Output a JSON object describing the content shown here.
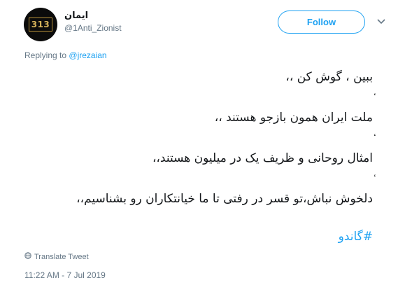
{
  "author": {
    "display_name": "ایمان",
    "handle": "@1Anti_Zionist",
    "avatar_text": "313"
  },
  "follow_button": {
    "label": "Follow"
  },
  "menu": {
    "icon": "chevron-down-icon"
  },
  "reply_context": {
    "prefix": "Replying to",
    "mention": "@jrezaian"
  },
  "tweet": {
    "lines": [
      "ببین ، گوش کن ،،",
      "ٔ",
      "ملت ایران همون بازجو هستند ،،",
      "ٔ",
      "امثال روحانی و ظریف یک در میلیون هستند،،",
      "ٔ",
      "دلخوش نباش،تو قسر در رفتی تا ما خیانتکاران رو بشناسیم،،"
    ],
    "hashtag": "#گاندو"
  },
  "translate": {
    "label": "Translate Tweet",
    "icon": "globe-icon"
  },
  "timestamp": "11:22 AM - 7 Jul 2019",
  "colors": {
    "accent": "#1da1f2",
    "muted": "#657786",
    "text": "#14171a"
  }
}
